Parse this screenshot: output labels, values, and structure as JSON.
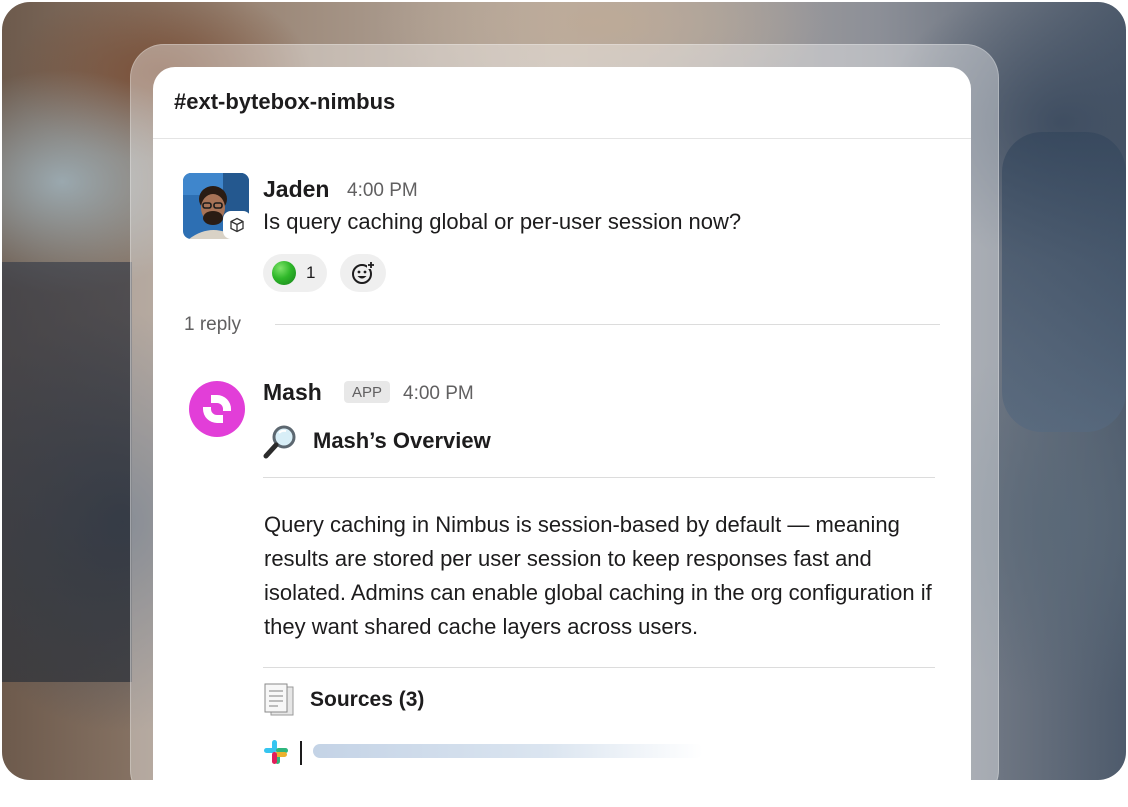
{
  "channel": {
    "title": "#ext-bytebox-nimbus"
  },
  "messages": [
    {
      "author": "Jaden",
      "time": "4:00 PM",
      "text": "Is query caching global or per-user session now?",
      "reaction": {
        "emoji": "green-circle",
        "count": "1"
      },
      "reply_count": "1 reply"
    },
    {
      "author": "Mash",
      "badge": "APP",
      "time": "4:00 PM",
      "overview_title": "Mash’s Overview",
      "body": "Query caching in Nimbus is session-based by default — meaning results are stored per user session to keep responses fast and isolated. Admins can enable global caching in the org configuration if they want shared cache layers across users.",
      "sources_label": "Sources (3)"
    }
  ],
  "colors": {
    "mash_brand": "#e23ed8",
    "reaction_bg": "#efefef",
    "text": "#1d1c1d",
    "muted": "#616061"
  },
  "icons": [
    "magnifying-glass-icon",
    "add-reaction-icon",
    "document-icon",
    "slack-icon",
    "cube-badge-icon"
  ]
}
